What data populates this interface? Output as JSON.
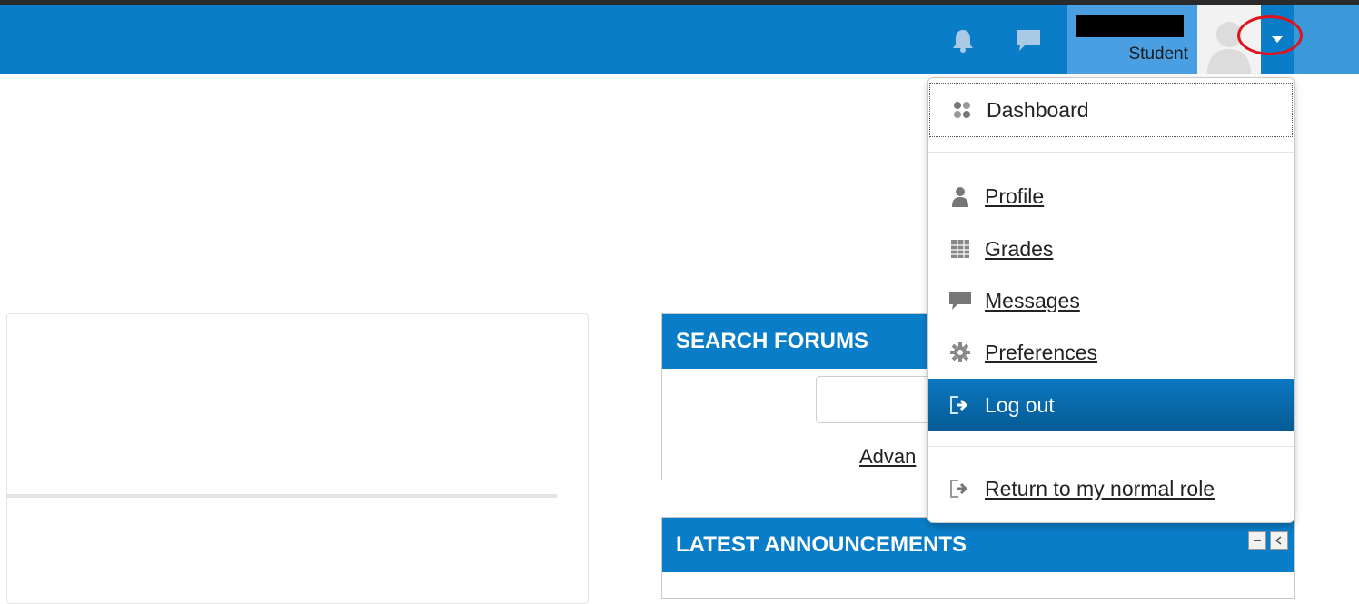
{
  "navbar": {
    "user_role": "Student",
    "icons": {
      "notifications": "bell-icon",
      "messages": "chat-icon",
      "menu_toggle": "caret-down-icon"
    },
    "colors": {
      "bar": "#0a7dc8",
      "highlight_circle": "#e0121b"
    }
  },
  "user_menu": {
    "items": [
      {
        "label": "Dashboard",
        "icon": "dashboard-icon"
      },
      {
        "label": "Profile",
        "icon": "user-icon"
      },
      {
        "label": "Grades",
        "icon": "grades-table-icon"
      },
      {
        "label": "Messages",
        "icon": "message-icon"
      },
      {
        "label": "Preferences",
        "icon": "gear-icon"
      },
      {
        "label": "Log out",
        "icon": "logout-icon"
      },
      {
        "label": "Return to my normal role",
        "icon": "return-role-icon"
      }
    ]
  },
  "blocks": {
    "search_forums": {
      "title": "SEARCH FORUMS",
      "advanced_link": "Advan"
    },
    "latest_announcements": {
      "title": "LATEST ANNOUNCEMENTS"
    }
  }
}
